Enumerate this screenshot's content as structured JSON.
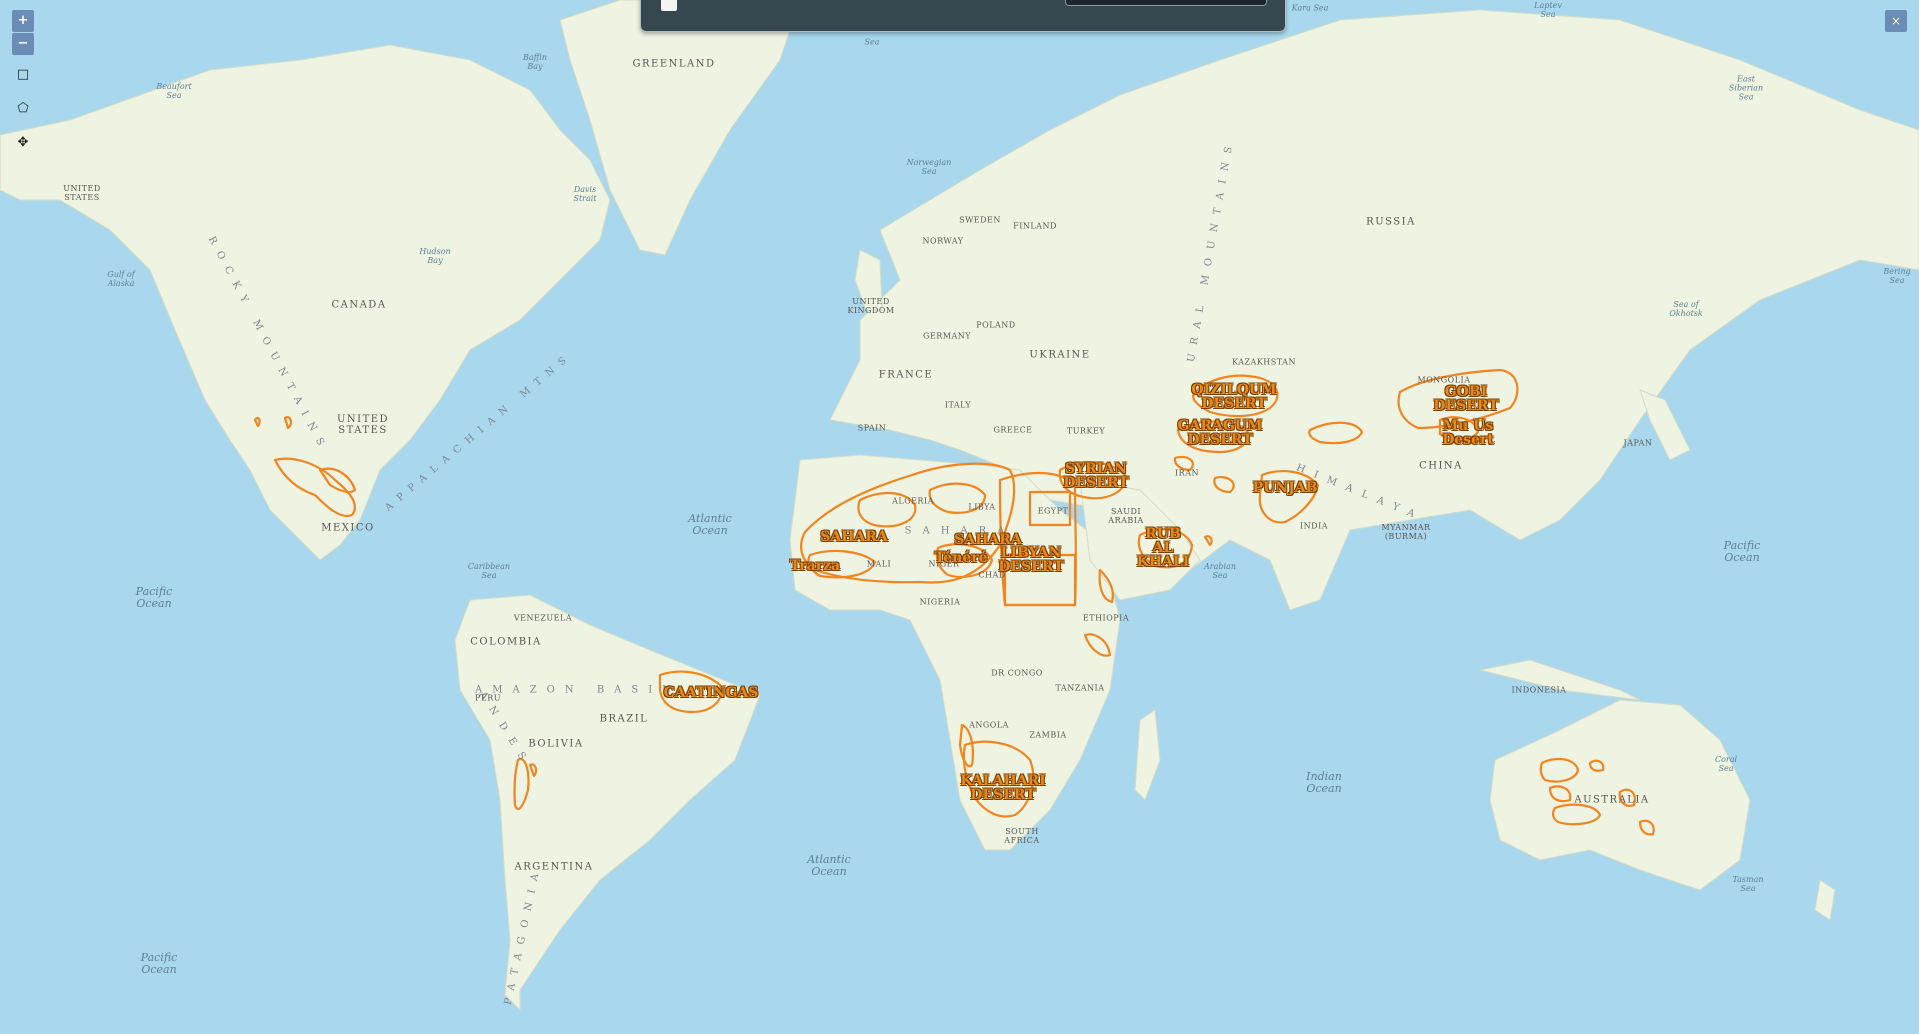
{
  "controls": {
    "zoom_in": "+",
    "zoom_out": "−",
    "rect_tool": "□",
    "polygon_tool": "⬠",
    "pan_tool": "✥",
    "close": "×"
  },
  "colors": {
    "ocean": "#a9d8ee",
    "land": "#eef3e2",
    "desert_outline": "#f2851f",
    "desert_label": "#e8891b"
  },
  "labels": {
    "countries": [
      {
        "id": "greenland",
        "text": "GREENLAND"
      },
      {
        "id": "united-states-west",
        "text": "UNITED\nSTATES"
      },
      {
        "id": "canada",
        "text": "CANADA"
      },
      {
        "id": "united-states",
        "text": "UNITED\nSTATES"
      },
      {
        "id": "mexico",
        "text": "MEXICO"
      },
      {
        "id": "venezuela",
        "text": "VENEZUELA"
      },
      {
        "id": "colombia",
        "text": "COLOMBIA"
      },
      {
        "id": "peru",
        "text": "PERU"
      },
      {
        "id": "brazil",
        "text": "BRAZIL"
      },
      {
        "id": "bolivia",
        "text": "BOLIVIA"
      },
      {
        "id": "argentina",
        "text": "ARGENTINA"
      },
      {
        "id": "sweden",
        "text": "SWEDEN"
      },
      {
        "id": "finland",
        "text": "FINLAND"
      },
      {
        "id": "norway",
        "text": "NORWAY"
      },
      {
        "id": "united-kingdom",
        "text": "UNITED\nKINGDOM"
      },
      {
        "id": "poland",
        "text": "POLAND"
      },
      {
        "id": "germany",
        "text": "GERMANY"
      },
      {
        "id": "ukraine",
        "text": "UKRAINE"
      },
      {
        "id": "france",
        "text": "FRANCE"
      },
      {
        "id": "italy",
        "text": "ITALY"
      },
      {
        "id": "spain",
        "text": "SPAIN"
      },
      {
        "id": "greece",
        "text": "GREECE"
      },
      {
        "id": "turkey",
        "text": "TURKEY"
      },
      {
        "id": "algeria",
        "text": "ALGERIA"
      },
      {
        "id": "libya",
        "text": "LIBYA"
      },
      {
        "id": "egypt",
        "text": "EGYPT"
      },
      {
        "id": "mali",
        "text": "MALI"
      },
      {
        "id": "niger",
        "text": "NIGER"
      },
      {
        "id": "chad",
        "text": "CHAD"
      },
      {
        "id": "nigeria",
        "text": "NIGERIA"
      },
      {
        "id": "ethiopia",
        "text": "ETHIOPIA"
      },
      {
        "id": "dr-congo",
        "text": "DR CONGO"
      },
      {
        "id": "tanzania",
        "text": "TANZANIA"
      },
      {
        "id": "angola",
        "text": "ANGOLA"
      },
      {
        "id": "zambia",
        "text": "ZAMBIA"
      },
      {
        "id": "south-africa",
        "text": "SOUTH\nAFRICA"
      },
      {
        "id": "saudi-arabia",
        "text": "SAUDI\nARABIA"
      },
      {
        "id": "iran",
        "text": "IRAN"
      },
      {
        "id": "kazakhstan",
        "text": "KAZAKHSTAN"
      },
      {
        "id": "russia",
        "text": "RUSSIA"
      },
      {
        "id": "mongolia",
        "text": "MONGOLIA"
      },
      {
        "id": "china",
        "text": "CHINA"
      },
      {
        "id": "india",
        "text": "INDIA"
      },
      {
        "id": "myanmar",
        "text": "MYANMAR\n(BURMA)"
      },
      {
        "id": "japan",
        "text": "JAPAN"
      },
      {
        "id": "indonesia",
        "text": "INDONESIA"
      },
      {
        "id": "australia",
        "text": "AUSTRALIA"
      }
    ],
    "oceans": [
      {
        "id": "beaufort-sea",
        "text": "Beaufort\nSea"
      },
      {
        "id": "baffin-bay",
        "text": "Baffin\nBay"
      },
      {
        "id": "davis-strait",
        "text": "Davis\nStrait"
      },
      {
        "id": "hudson-bay",
        "text": "Hudson\nBay"
      },
      {
        "id": "gulf-of-alaska",
        "text": "Gulf of\nAlaska"
      },
      {
        "id": "greenland-sea",
        "text": "Sea"
      },
      {
        "id": "norwegian-sea",
        "text": "Norwegian\nSea"
      },
      {
        "id": "kara-sea",
        "text": "Kara Sea"
      },
      {
        "id": "laptev-sea",
        "text": "Laptev\nSea"
      },
      {
        "id": "east-siberian-sea",
        "text": "East\nSiberian\nSea"
      },
      {
        "id": "bering-sea",
        "text": "Bering\nSea"
      },
      {
        "id": "sea-of-okhotsk",
        "text": "Sea of\nOkhotsk"
      },
      {
        "id": "caribbean-sea",
        "text": "Caribbean\nSea"
      },
      {
        "id": "atlantic-north",
        "text": "Atlantic\nOcean"
      },
      {
        "id": "pacific-ne",
        "text": "Pacific\nOcean"
      },
      {
        "id": "atlantic-south",
        "text": "Atlantic\nOcean"
      },
      {
        "id": "pacific-sw",
        "text": "Pacific\nOcean"
      },
      {
        "id": "arabian-sea",
        "text": "Arabian\nSea"
      },
      {
        "id": "indian-ocean",
        "text": "Indian\nOcean"
      },
      {
        "id": "pacific-w",
        "text": "Pacific\nOcean"
      },
      {
        "id": "coral-sea",
        "text": "Coral\nSea"
      },
      {
        "id": "tasman-sea",
        "text": "Tasman\nSea"
      }
    ],
    "regions": [
      {
        "id": "rocky-mountains",
        "text": "ROCKY MOUNTAINS"
      },
      {
        "id": "appalachian-mtns",
        "text": "APPALACHIAN MTNS"
      },
      {
        "id": "amazon-basin",
        "text": "AMAZON BASIN"
      },
      {
        "id": "andes",
        "text": "ANDES"
      },
      {
        "id": "patagonia",
        "text": "PATAGONIA"
      },
      {
        "id": "ural-mountains",
        "text": "URAL MOUNTAINS"
      },
      {
        "id": "himalaya",
        "text": "HIMALAYA"
      },
      {
        "id": "sahara-region",
        "text": "SAHARA"
      }
    ],
    "deserts": [
      {
        "id": "qizilqum",
        "text": "QIZILQUM\nDESERT"
      },
      {
        "id": "garagum",
        "text": "GARAGUM\nDESERT"
      },
      {
        "id": "gobi",
        "text": "GOBI\nDESERT"
      },
      {
        "id": "mu-us",
        "text": "Mu Us\nDesert"
      },
      {
        "id": "syrian",
        "text": "SYRIAN\nDESERT"
      },
      {
        "id": "punjab",
        "text": "PUNJAB"
      },
      {
        "id": "rub-al-khali",
        "text": "RUB\nAL\nKHALI"
      },
      {
        "id": "sahara-west",
        "text": "SAHARA"
      },
      {
        "id": "sahara-east",
        "text": "SAHARA"
      },
      {
        "id": "tenere",
        "text": "Ténéré"
      },
      {
        "id": "libyan",
        "text": "LIBYAN\nDESERT"
      },
      {
        "id": "trarza",
        "text": "Trarza"
      },
      {
        "id": "caatingas",
        "text": "CAATINGAS"
      },
      {
        "id": "kalahari",
        "text": "KALAHARI\nDESERT"
      }
    ]
  }
}
